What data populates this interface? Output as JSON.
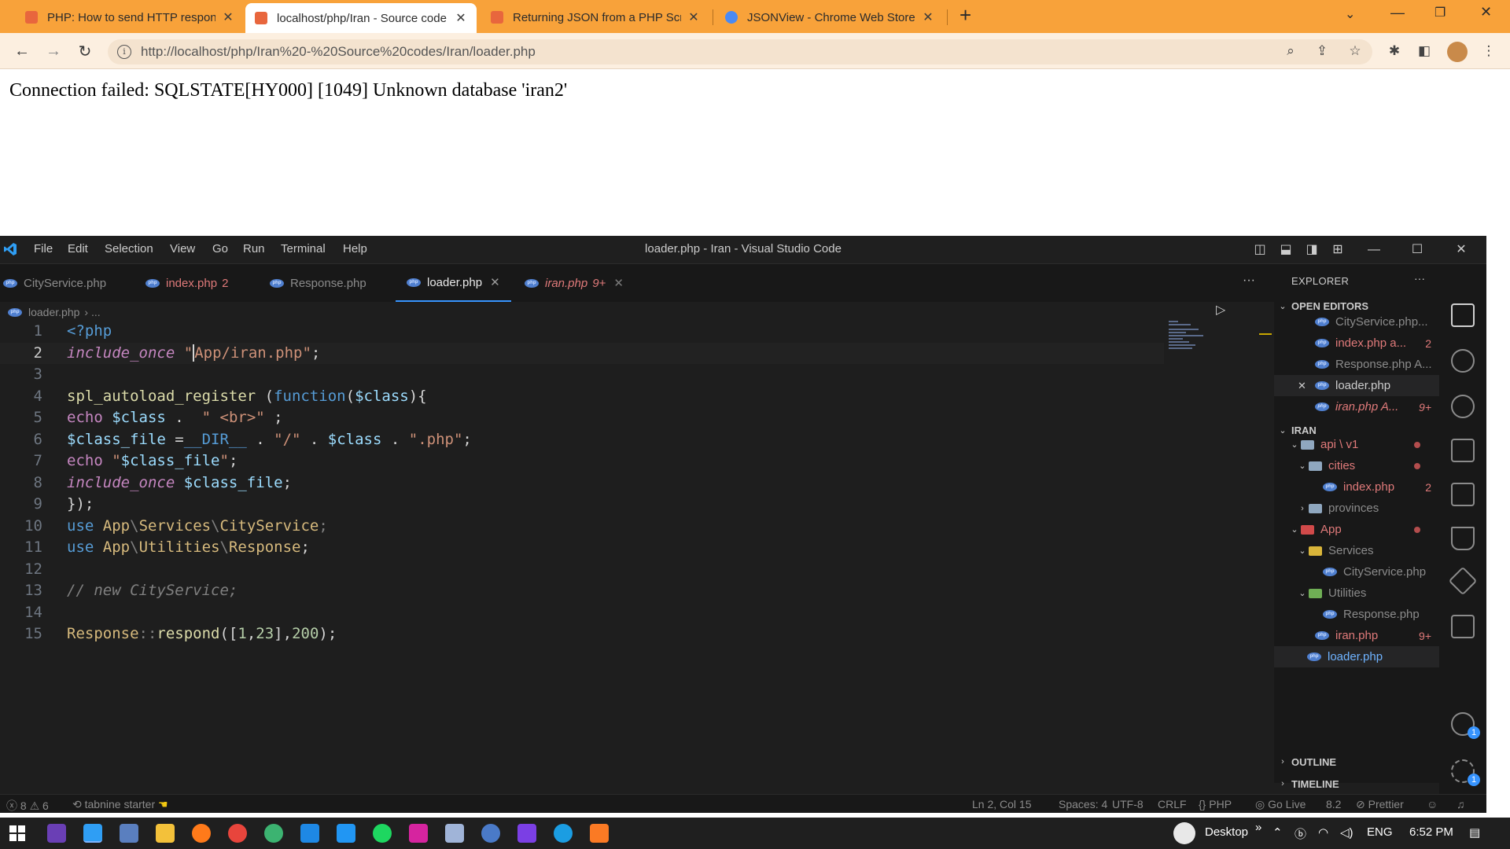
{
  "browser": {
    "tabs": [
      {
        "title": "PHP: How to send HTTP respons",
        "favicon_color": "#e8663d"
      },
      {
        "title": "localhost/php/Iran - Source code",
        "favicon_color": "#e8663d"
      },
      {
        "title": "Returning JSON from a PHP Scrip",
        "favicon_color": "#e8663d"
      },
      {
        "title": "JSONView - Chrome Web Store",
        "favicon_color": "#4a8af4"
      }
    ],
    "tab_close": "✕",
    "new_tab": "+",
    "url": "http://localhost/php/Iran%20-%20Source%20codes/Iran/loader.php"
  },
  "page": {
    "error_message": "Connection failed: SQLSTATE[HY000] [1049] Unknown database 'iran2'"
  },
  "vscode": {
    "menu": [
      "File",
      "Edit",
      "Selection",
      "View",
      "Go",
      "Run",
      "Terminal",
      "Help"
    ],
    "window_title": "loader.php - Iran - Visual Studio Code",
    "tabs": [
      {
        "label": "CityService.php",
        "badge": ""
      },
      {
        "label": "index.php",
        "badge": "2"
      },
      {
        "label": "Response.php",
        "badge": ""
      },
      {
        "label": "loader.php",
        "badge": ""
      },
      {
        "label": "iran.php",
        "badge": "9+"
      }
    ],
    "breadcrumb": "loader.php",
    "breadcrumb_sep": "› ...",
    "line_numbers": [
      "1",
      "2",
      "3",
      "4",
      "5",
      "6",
      "7",
      "8",
      "9",
      "10",
      "11",
      "12",
      "13",
      "14",
      "15"
    ],
    "explorer": {
      "title": "EXPLORER",
      "open_editors_label": "OPEN EDITORS",
      "open_editors": [
        {
          "label": "CityService.php...",
          "badge": ""
        },
        {
          "label": "index.php a...",
          "badge": "2"
        },
        {
          "label": "Response.php A...",
          "badge": ""
        },
        {
          "label": "loader.php",
          "badge": ""
        },
        {
          "label": "iran.php A...",
          "badge": "9+"
        }
      ],
      "project_label": "IRAN",
      "tree": [
        {
          "label": "api \\ v1",
          "badge": ""
        },
        {
          "label": "cities",
          "badge": ""
        },
        {
          "label": "index.php",
          "badge": "2"
        },
        {
          "label": "provinces",
          "badge": ""
        },
        {
          "label": "App",
          "badge": ""
        },
        {
          "label": "Services",
          "badge": ""
        },
        {
          "label": "CityService.php",
          "badge": ""
        },
        {
          "label": "Utilities",
          "badge": ""
        },
        {
          "label": "Response.php",
          "badge": ""
        },
        {
          "label": "iran.php",
          "badge": "9+"
        },
        {
          "label": "loader.php",
          "badge": ""
        }
      ],
      "outline_label": "OUTLINE",
      "timeline_label": "TIMELINE"
    },
    "status": {
      "errors": "8",
      "warnings": "6",
      "tabnine": "tabnine starter",
      "position": "Ln 2, Col 15",
      "spaces": "Spaces: 4",
      "encoding": "UTF-8",
      "eol": "CRLF",
      "language": "PHP",
      "golive": "Go Live",
      "version": "8.2",
      "prettier": "Prettier"
    },
    "activity_badges": [
      "1",
      "1"
    ]
  },
  "taskbar": {
    "desktop_label": "Desktop",
    "chevron": "»",
    "lang": "ENG",
    "time": "6:52 PM"
  }
}
